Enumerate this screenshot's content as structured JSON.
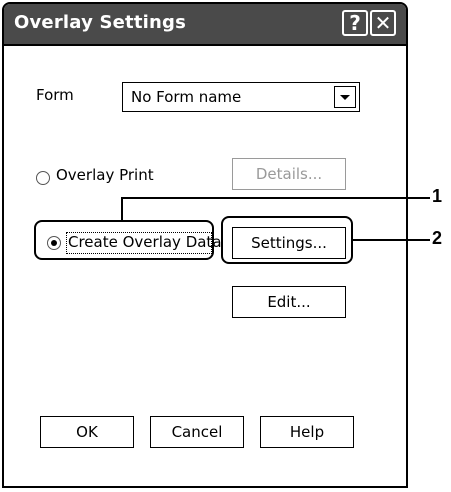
{
  "dialog": {
    "title": "Overlay Settings",
    "help_button": "?",
    "close_button": "✕"
  },
  "form": {
    "label": "Form",
    "selected": "No Form name"
  },
  "options": {
    "overlay_print_label": "Overlay Print",
    "overlay_print_checked": false,
    "create_overlay_label": "Create Overlay Data",
    "create_overlay_checked": true
  },
  "buttons": {
    "details": "Details...",
    "settings": "Settings...",
    "edit": "Edit...",
    "ok": "OK",
    "cancel": "Cancel",
    "help": "Help"
  },
  "callouts": {
    "one": "1",
    "two": "2"
  }
}
